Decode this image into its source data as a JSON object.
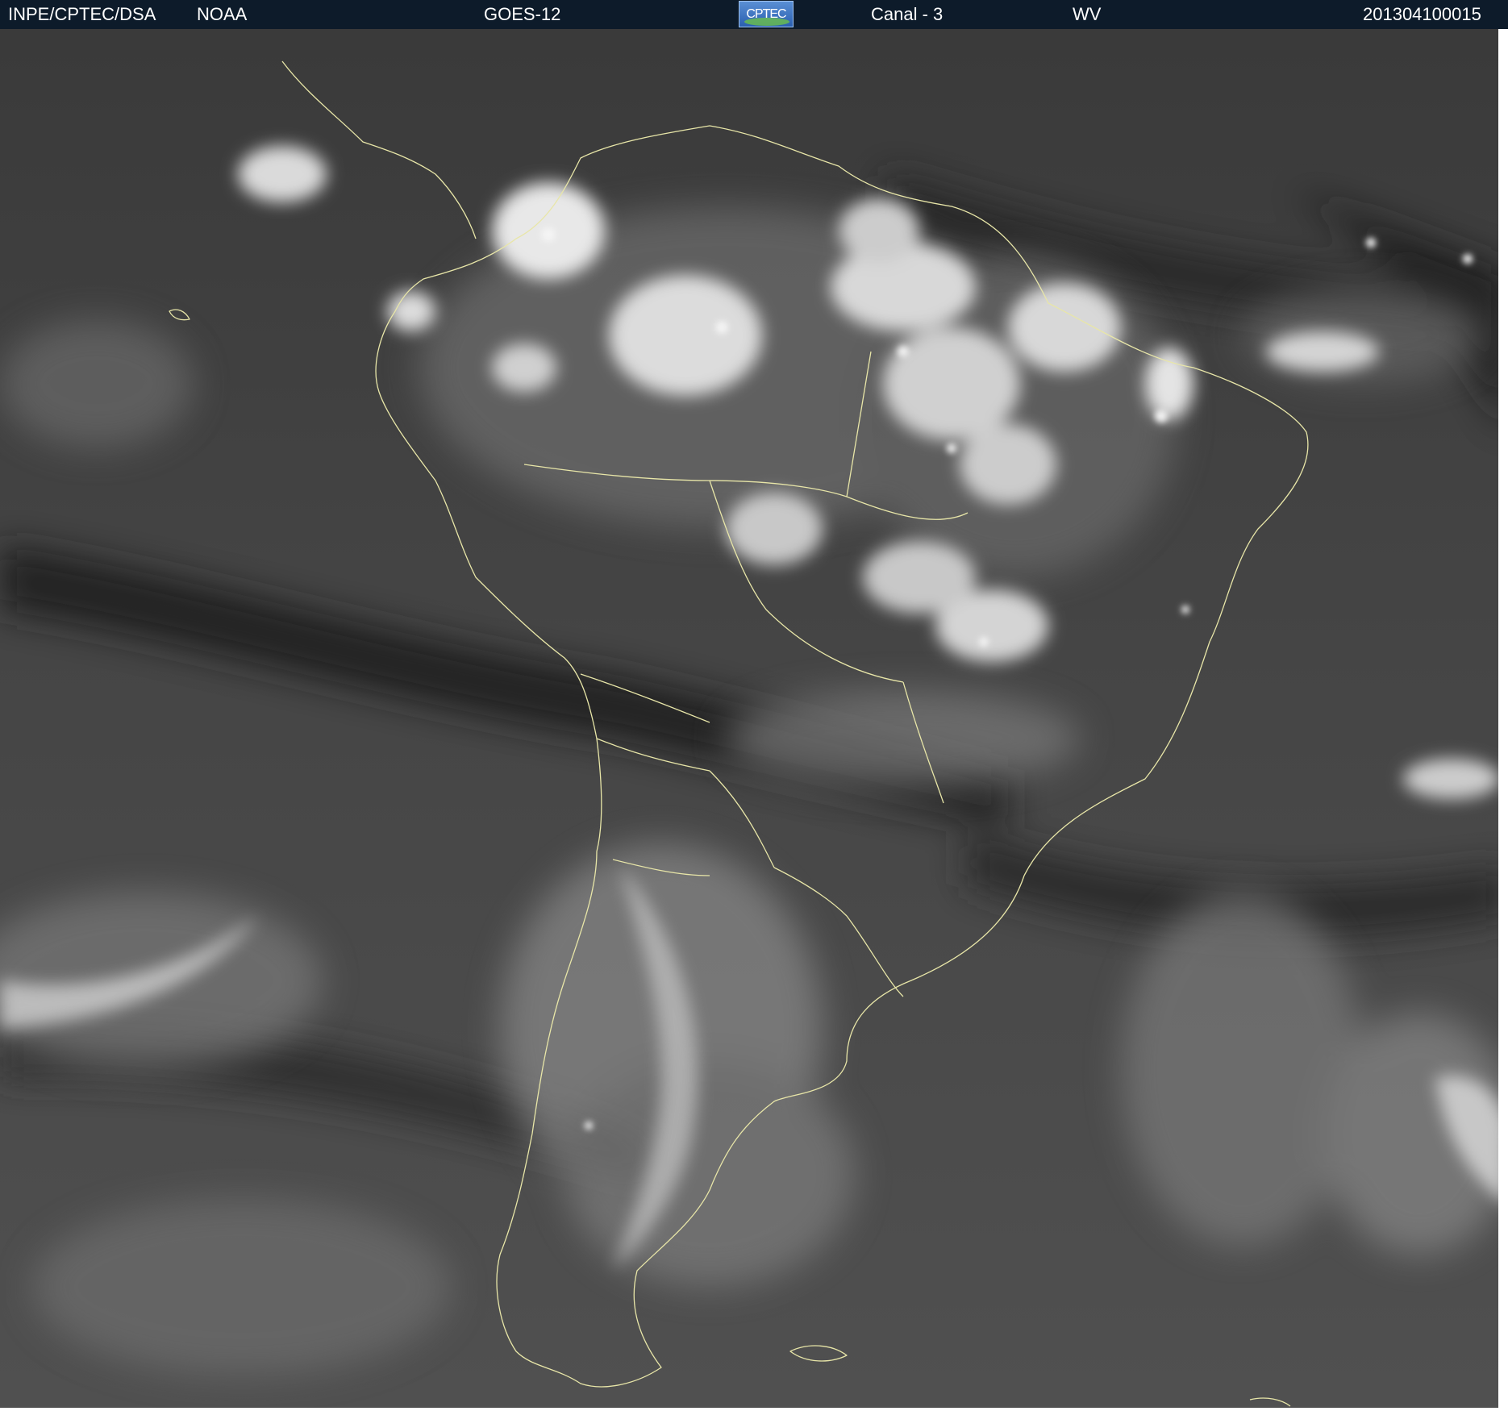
{
  "header": {
    "institution": "INPE/CPTEC/DSA",
    "agency": "NOAA",
    "satellite": "GOES-12",
    "logo_text": "CPTEC",
    "channel": "Canal - 3",
    "band": "WV",
    "timestamp": "201304100015"
  },
  "colors": {
    "header_background": "#0d1b2a",
    "header_text": "#ffffff",
    "coastline": "#e8e6a8"
  },
  "image": {
    "kind": "water-vapor satellite imagery",
    "palette": "grayscale"
  }
}
